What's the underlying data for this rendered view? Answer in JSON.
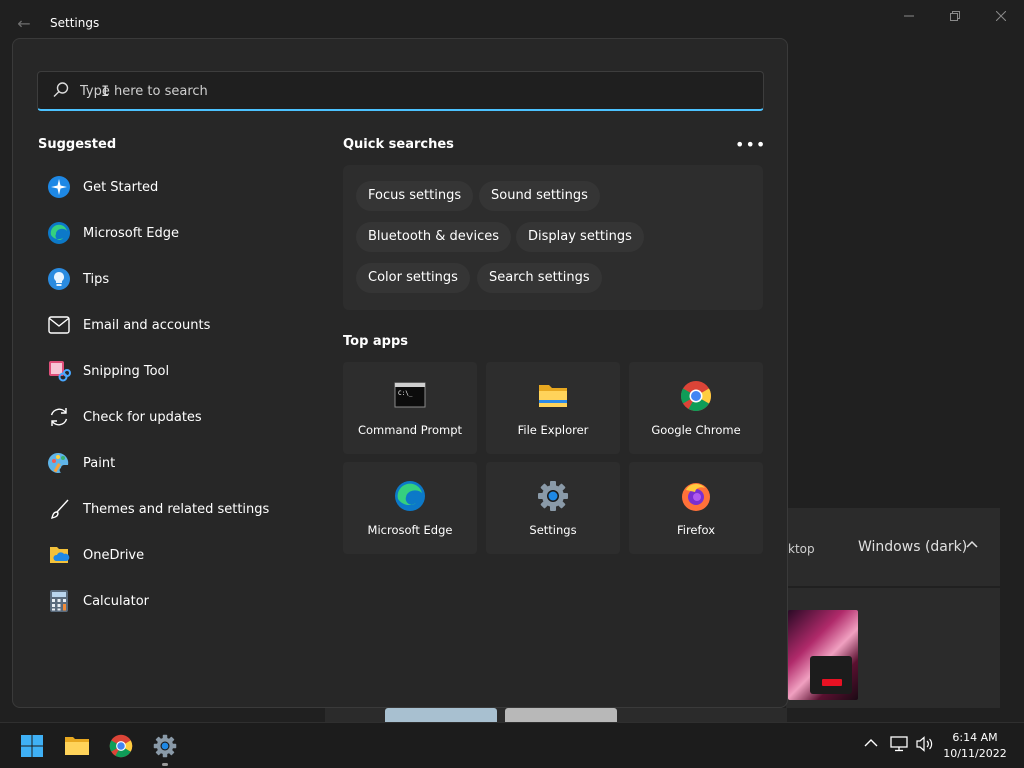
{
  "window": {
    "title": "Settings",
    "controls": [
      "minimize",
      "restore",
      "close"
    ]
  },
  "background": {
    "partial_text": "ktop",
    "theme_value": "Windows (dark)"
  },
  "search": {
    "placeholder": "Type here to search",
    "value": ""
  },
  "suggested": {
    "title": "Suggested",
    "items": [
      {
        "label": "Get Started",
        "icon": "get-started-icon"
      },
      {
        "label": "Microsoft Edge",
        "icon": "edge-icon"
      },
      {
        "label": "Tips",
        "icon": "tips-icon"
      },
      {
        "label": "Email and accounts",
        "icon": "mail-icon"
      },
      {
        "label": "Snipping Tool",
        "icon": "snipping-tool-icon"
      },
      {
        "label": "Check for updates",
        "icon": "refresh-icon"
      },
      {
        "label": "Paint",
        "icon": "paint-icon"
      },
      {
        "label": "Themes and related settings",
        "icon": "brush-icon"
      },
      {
        "label": "OneDrive",
        "icon": "onedrive-icon"
      },
      {
        "label": "Calculator",
        "icon": "calculator-icon"
      }
    ]
  },
  "quick_searches": {
    "title": "Quick searches",
    "chips": [
      "Focus settings",
      "Sound settings",
      "Bluetooth & devices",
      "Display settings",
      "Color settings",
      "Search settings"
    ]
  },
  "top_apps": {
    "title": "Top apps",
    "apps": [
      {
        "label": "Command Prompt",
        "icon": "command-prompt-icon"
      },
      {
        "label": "File Explorer",
        "icon": "file-explorer-icon"
      },
      {
        "label": "Google Chrome",
        "icon": "chrome-icon"
      },
      {
        "label": "Microsoft Edge",
        "icon": "edge-icon"
      },
      {
        "label": "Settings",
        "icon": "settings-gear-icon"
      },
      {
        "label": "Firefox",
        "icon": "firefox-icon"
      }
    ]
  },
  "taskbar": {
    "time": "6:14 AM",
    "date": "10/11/2022"
  },
  "colors": {
    "accent": "#4cc2ff",
    "background": "#202020",
    "flyout": "#272727"
  }
}
